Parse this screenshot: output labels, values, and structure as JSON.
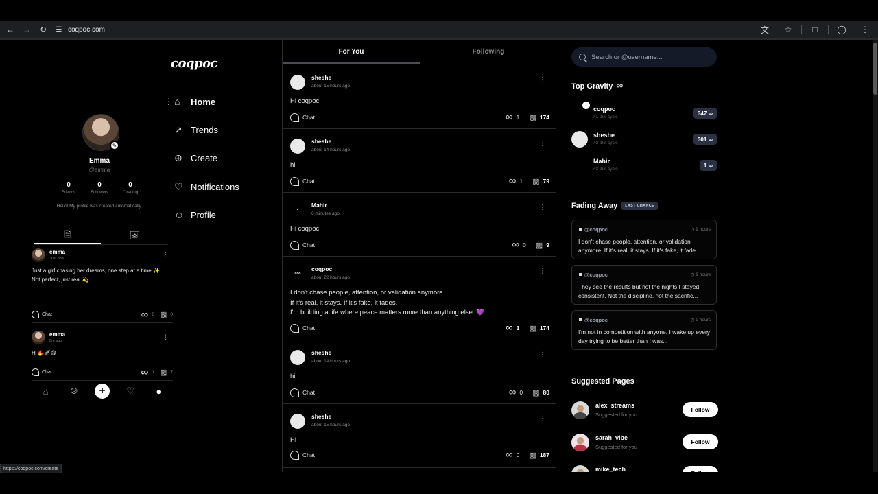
{
  "browser": {
    "url": "coqpoc.com",
    "status_url": "https://coqpoc.com/create"
  },
  "brand": "coqpoc",
  "profile": {
    "name": "Emma",
    "handle": "@emma",
    "stats": [
      {
        "value": "0",
        "label": "Friends"
      },
      {
        "value": "0",
        "label": "Followers"
      },
      {
        "value": "0",
        "label": "Chatting"
      }
    ],
    "bio": "Hello! My profile was created automatically.",
    "posts": [
      {
        "user": "emma",
        "time": "Just now",
        "text": "Just a girl chasing her dreams, one step at a time ✨\nNot perfect, just real 💫",
        "chat_label": "Chat",
        "gravity": "0",
        "views": "0"
      },
      {
        "user": "emma",
        "time": "8m ago",
        "text": "Hi🔥🚀😋",
        "chat_label": "Chat",
        "gravity": "1",
        "views": "7"
      }
    ]
  },
  "mainnav": [
    {
      "label": "Home",
      "icon": "home-icon",
      "active": true
    },
    {
      "label": "Trends",
      "icon": "trends-icon"
    },
    {
      "label": "Create",
      "icon": "create-icon"
    },
    {
      "label": "Notifications",
      "icon": "notifications-icon"
    },
    {
      "label": "Profile",
      "icon": "profile-icon"
    }
  ],
  "feed": {
    "tabs": [
      "For You",
      "Following"
    ],
    "posts": [
      {
        "user": "sheshe",
        "time": "about 15 hours ago",
        "text": "Hi coqpoc",
        "chat": "Chat",
        "gravity": "1",
        "views": "174"
      },
      {
        "user": "sheshe",
        "time": "about 14 hours ago",
        "text": "hi",
        "chat": "Chat",
        "gravity": "1",
        "views": "79"
      },
      {
        "user": "Mahir",
        "time": "6 minutes ago",
        "text": "Hi coqpoc",
        "chat": "Chat",
        "gravity": "0",
        "views": "9"
      },
      {
        "user": "coqpoc",
        "time": "about 22 hours ago",
        "text": "I don't chase people, attention, or validation anymore.\nIf it's real, it stays. If it's fake, it fades.\nI'm building a life where peace matters more than anything else. 💜",
        "chat": "Chat",
        "gravity": "1",
        "views": "174"
      },
      {
        "user": "sheshe",
        "time": "about 14 hours ago",
        "text": "hi",
        "chat": "Chat",
        "gravity": "0",
        "views": "80"
      },
      {
        "user": "sheshe",
        "time": "about 15 hours ago",
        "text": "Hi",
        "chat": "Chat",
        "gravity": "0",
        "views": "187"
      }
    ]
  },
  "search": {
    "placeholder": "Search or @username..."
  },
  "top_gravity": {
    "title": "Top Gravity",
    "rows": [
      {
        "name": "coqpoc",
        "sub": "#1 this cycle",
        "score": "347",
        "badge": "1"
      },
      {
        "name": "sheshe",
        "sub": "#2 this cycle",
        "score": "301"
      },
      {
        "name": "Mahir",
        "sub": "#3 this cycle",
        "score": "1"
      }
    ]
  },
  "fading_away": {
    "title": "Fading Away",
    "badge": "LAST CHANCE",
    "cards": [
      {
        "handle": "@coqpoc",
        "time": "9 hours",
        "text": "I don't chase people, attention, or validation anymore. If it's real, it stays. If it's fake, it fade..."
      },
      {
        "handle": "@coqpoc",
        "time": "9 hours",
        "text": "They see the results but not the nights I stayed consistent. Not the discipline, not the sacrific..."
      },
      {
        "handle": "@coqpoc",
        "time": "9 hours",
        "text": "I'm not in competition with anyone. I wake up every day trying to be better than I was..."
      }
    ]
  },
  "suggested": {
    "title": "Suggested Pages",
    "rows": [
      {
        "name": "alex_streams",
        "sub": "Suggested for you",
        "button": "Follow"
      },
      {
        "name": "sarah_vibe",
        "sub": "Suggested for you",
        "button": "Follow"
      },
      {
        "name": "mike_tech",
        "sub": "",
        "button": "Follow"
      }
    ]
  }
}
